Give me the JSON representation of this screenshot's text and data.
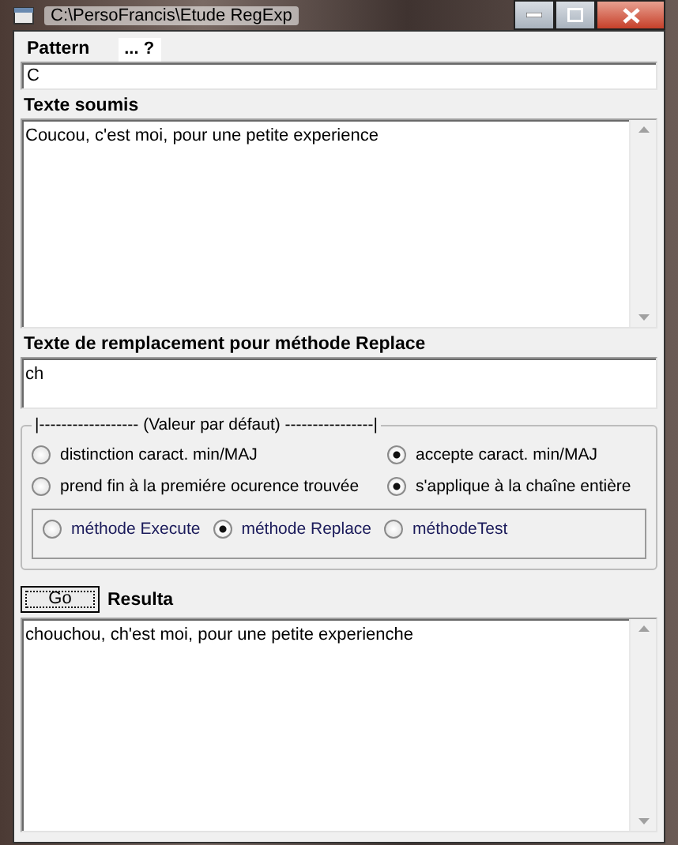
{
  "window": {
    "title": "C:\\PersoFrancis\\Etude RegExp"
  },
  "pattern": {
    "label": "Pattern",
    "help": "... ?",
    "value": "C"
  },
  "subject": {
    "label": "Texte soumis",
    "value": "Coucou, c'est moi, pour une petite experience"
  },
  "replacement": {
    "label": "Texte de remplacement pour méthode Replace",
    "value": "ch"
  },
  "options": {
    "legend": "|------------------ (Valeur par défaut) ----------------|",
    "case": [
      {
        "label": "distinction caract. min/MAJ",
        "selected": false
      },
      {
        "label": "accepte caract. min/MAJ",
        "selected": true
      }
    ],
    "scope": [
      {
        "label": "prend fin à la premiére ocurence trouvée",
        "selected": false
      },
      {
        "label": "s'applique à la chaîne entière",
        "selected": true
      }
    ],
    "methods": [
      {
        "label": "méthode Execute",
        "selected": false
      },
      {
        "label": "méthode Replace",
        "selected": true
      },
      {
        "label": "méthodeTest",
        "selected": false
      }
    ]
  },
  "go_button": "Go",
  "result": {
    "label": "Resulta",
    "value": "chouchou, ch'est moi, pour une petite experienche"
  }
}
